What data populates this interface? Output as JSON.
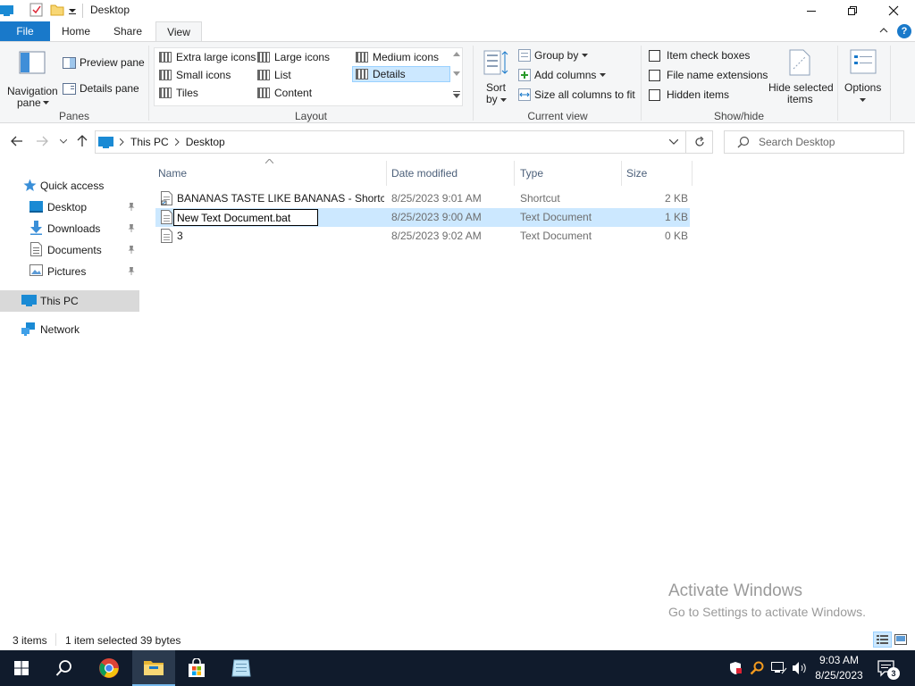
{
  "window": {
    "title": "Desktop"
  },
  "ribbon": {
    "tabs": [
      "File",
      "Home",
      "Share",
      "View"
    ],
    "help": "?",
    "panes": {
      "navigation_pane": [
        "Navigation",
        "pane"
      ],
      "preview_pane": "Preview pane",
      "details_pane": "Details pane",
      "label": "Panes"
    },
    "layout": {
      "items": [
        "Extra large icons",
        "Large icons",
        "Medium icons",
        "Small icons",
        "List",
        "Details",
        "Tiles",
        "Content"
      ],
      "selected": "Details",
      "label": "Layout"
    },
    "current_view": {
      "sort_by": [
        "Sort",
        "by"
      ],
      "group_by": "Group by",
      "add_columns": "Add columns",
      "size_columns": "Size all columns to fit",
      "label": "Current view"
    },
    "show_hide": {
      "item_check_boxes": "Item check boxes",
      "file_name_extensions": "File name extensions",
      "hidden_items": "Hidden items",
      "hide_selected": [
        "Hide selected",
        "items"
      ],
      "label": "Show/hide"
    },
    "options": "Options"
  },
  "address": {
    "crumbs": [
      "This PC",
      "Desktop"
    ],
    "search_placeholder": "Search Desktop"
  },
  "nav": {
    "quick_access": "Quick access",
    "pinned": [
      "Desktop",
      "Downloads",
      "Documents",
      "Pictures"
    ],
    "this_pc": "This PC",
    "network": "Network"
  },
  "columns": [
    "Name",
    "Date modified",
    "Type",
    "Size"
  ],
  "files": [
    {
      "name": "BANANAS TASTE LIKE BANANAS - Shortc...",
      "date": "8/25/2023 9:01 AM",
      "type": "Shortcut",
      "size": "2 KB"
    },
    {
      "name": "New Text Document.bat",
      "date": "8/25/2023 9:00 AM",
      "type": "Text Document",
      "size": "1 KB"
    },
    {
      "name": "3",
      "date": "8/25/2023 9:02 AM",
      "type": "Text Document",
      "size": "0 KB"
    }
  ],
  "status": {
    "count": "3 items",
    "selected": "1 item selected",
    "size": "39 bytes"
  },
  "watermark": {
    "line1": "Activate Windows",
    "line2": "Go to Settings to activate Windows."
  },
  "taskbar": {
    "time": "9:03 AM",
    "date": "8/25/2023",
    "notifications": "3"
  },
  "colors": {
    "accent": "#1979ca",
    "selection": "#cce8ff",
    "taskbar": "#101b2c"
  }
}
